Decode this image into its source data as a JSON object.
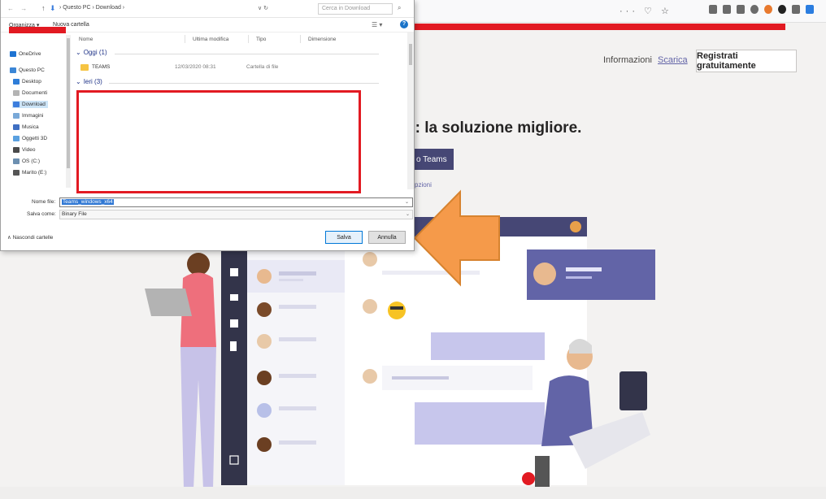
{
  "browser": {
    "url_icons": "··· ♡ ☆"
  },
  "page": {
    "nav_info": "Informazioni",
    "nav_scarica": "Scarica",
    "register_button": "Registrati gratuitamente",
    "hero_title": "o: la soluzione migliore.",
    "download_button": "o Teams",
    "small_link": "pzioni"
  },
  "dialog": {
    "path_back_forward": "← →",
    "path_up": "↑",
    "path_text": "› Questo PC › Download ›",
    "path_refresh": "∨ ↻",
    "search_placeholder": "Cerca in Download",
    "search_icon": "⌕",
    "organize": "Organizza ▾",
    "new_folder": "Nuova cartella",
    "view_icon": "☰ ▾",
    "help": "?",
    "nav_items": [
      {
        "label": "OneDrive",
        "icon": "onedrive-icon",
        "color": "#1e73d2"
      },
      {
        "label": "Questo PC",
        "icon": "pc-icon",
        "color": "#3b86d6"
      },
      {
        "label": "Desktop",
        "icon": "desktop-icon",
        "color": "#2e7dd8"
      },
      {
        "label": "Documenti",
        "icon": "documents-icon",
        "color": "#b4b4b4"
      },
      {
        "label": "Download",
        "icon": "download-icon",
        "color": "#3b7ddd",
        "selected": true
      },
      {
        "label": "Immagini",
        "icon": "images-icon",
        "color": "#7aa9d8"
      },
      {
        "label": "Musica",
        "icon": "music-icon",
        "color": "#3f6fc2"
      },
      {
        "label": "Oggetti 3D",
        "icon": "objects-3d-icon",
        "color": "#5aa0e0"
      },
      {
        "label": "Video",
        "icon": "video-icon",
        "color": "#4a4a4a"
      },
      {
        "label": "OS (C:)",
        "icon": "drive-icon",
        "color": "#6c8fb0"
      },
      {
        "label": "Marito (E:)",
        "icon": "network-drive-icon",
        "color": "#555555"
      }
    ],
    "columns": {
      "name": "Nome",
      "modified": "Ultima modifica",
      "type": "Tipo",
      "size": "Dimensione"
    },
    "groups": {
      "today": "Oggi (1)",
      "yesterday": "Ieri (3)"
    },
    "files": [
      {
        "name": "TEAMS",
        "modified": "12/03/2020 08:31",
        "type": "Cartella di file"
      }
    ],
    "filename_label": "Nome file:",
    "filename_value": "Teams_windows_x64",
    "savetype_label": "Salva come:",
    "savetype_value": "Binary File",
    "hide_folders": "∧ Nascondi cartelle",
    "save_button": "Salva",
    "cancel_button": "Annulla"
  },
  "colors": {
    "highlight_red": "#e21a22",
    "arrow_orange": "#f59a4a",
    "teams_purple": "#464775"
  }
}
